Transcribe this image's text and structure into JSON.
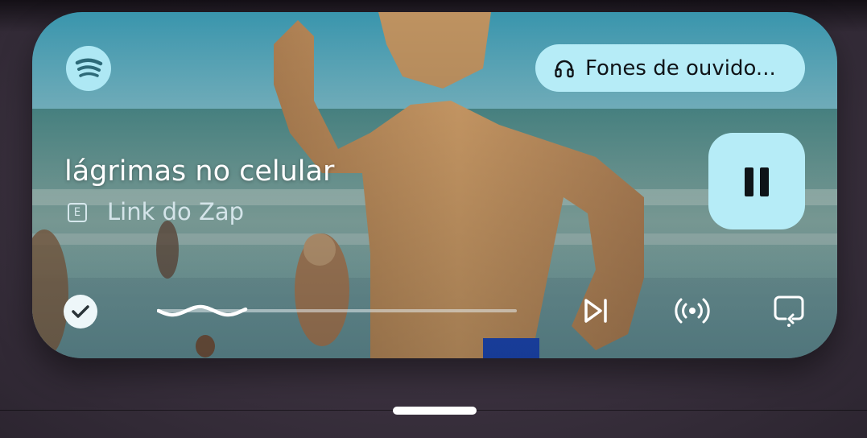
{
  "app": "Spotify",
  "output_device": {
    "label": "Fones de ouvido...",
    "icon": "headphones-icon"
  },
  "track": {
    "title": "lágrimas no celular",
    "explicit_badge": "E",
    "artist": "Link do Zap"
  },
  "playback": {
    "state": "playing",
    "progress": 0.25
  },
  "controls": {
    "play_pause_icon": "pause-icon",
    "liked_icon": "check-icon",
    "next_icon": "skip-next-icon",
    "broadcast_icon": "broadcast-icon",
    "repeat_icon": "repeat-icon"
  },
  "colors": {
    "accent": "#b6ecf7",
    "logo": "#aee8f4",
    "text_primary": "#ffffff",
    "text_secondary": "#d4e4e9"
  }
}
